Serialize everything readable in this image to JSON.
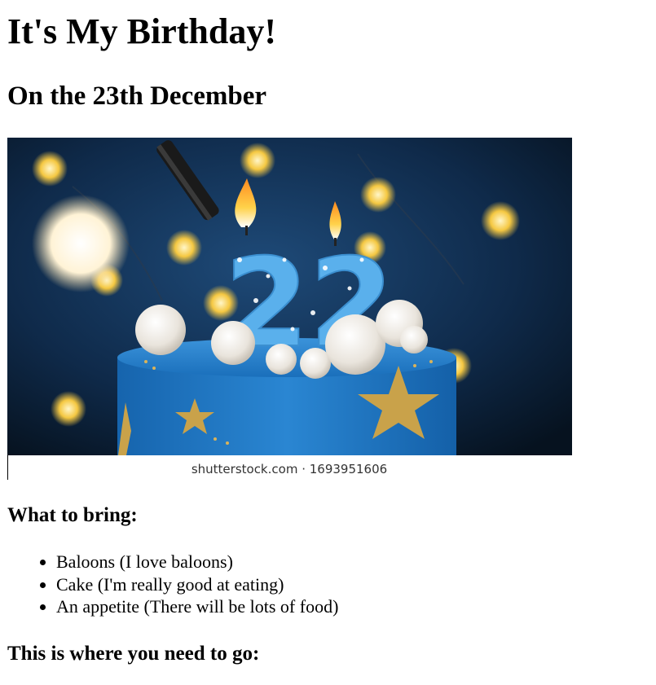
{
  "page": {
    "title": "It's My Birthday!",
    "subtitle": "On the 23th December"
  },
  "photo": {
    "cake_number": "22",
    "watermark": "shutterstock.com · 1693951606"
  },
  "bring_section": {
    "heading": "What to bring:",
    "items": [
      "Baloons (I love baloons)",
      "Cake (I'm really good at eating)",
      "An appetite (There will be lots of food)"
    ]
  },
  "directions": {
    "heading": "This is where you need to go:"
  },
  "colors": {
    "cake": "#1e78c8",
    "background": "#0c1f38",
    "candle": "#5ab0ec",
    "gold": "#c9a24a"
  }
}
